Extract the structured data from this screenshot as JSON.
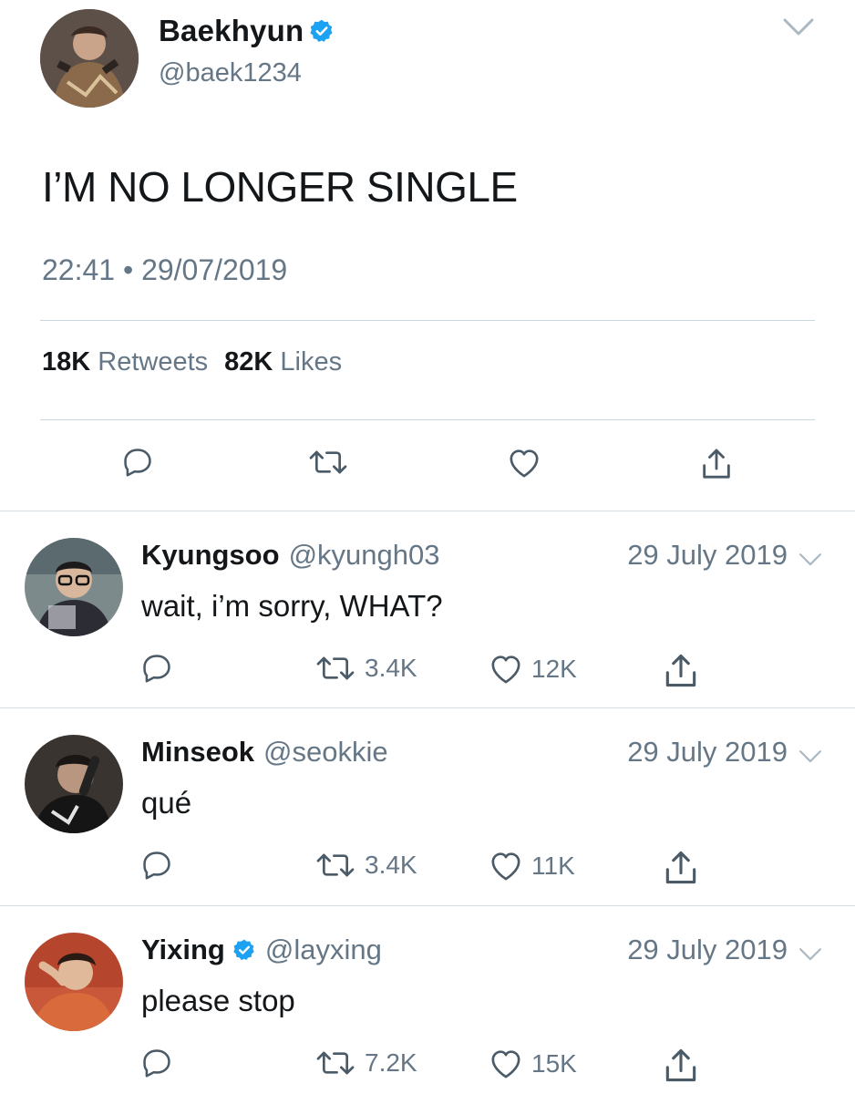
{
  "main_tweet": {
    "name": "Baekhyun",
    "handle": "@baek1234",
    "verified": true,
    "text": "I’M NO LONGER SINGLE",
    "time": "22:41",
    "date": "29/07/2019",
    "retweets_count": "18K",
    "retweets_label": "Retweets",
    "likes_count": "82K",
    "likes_label": "Likes"
  },
  "replies": [
    {
      "name": "Kyungsoo",
      "handle": "@kyungh03",
      "verified": false,
      "date": "29 July 2019",
      "text": "wait, i’m sorry, WHAT?",
      "retweets": "3.4K",
      "likes": "12K"
    },
    {
      "name": "Minseok",
      "handle": "@seokkie",
      "verified": false,
      "date": "29 July 2019",
      "text": "qué",
      "retweets": "3.4K",
      "likes": "11K"
    },
    {
      "name": "Yixing",
      "handle": "@layxing",
      "verified": true,
      "date": "29 July 2019",
      "text": "please stop",
      "retweets": "7.2K",
      "likes": "15K"
    }
  ],
  "colors": {
    "text": "#14171a",
    "secondary": "#657786",
    "verified": "#1da1f2",
    "divider": "#ccd6dd"
  },
  "icons": {
    "reply": "reply-icon",
    "retweet": "retweet-icon",
    "like": "heart-icon",
    "share": "share-icon",
    "menu": "chevron-down-icon",
    "verified": "verified-badge-icon"
  }
}
